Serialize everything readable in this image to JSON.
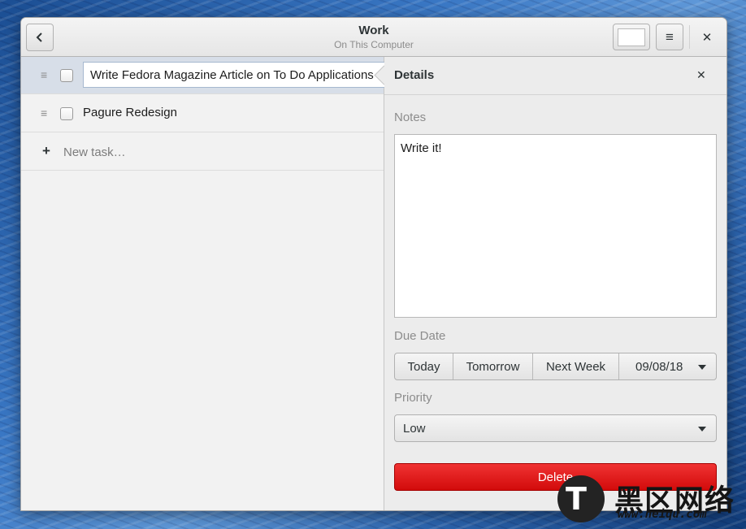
{
  "window": {
    "title": "Work",
    "subtitle": "On This Computer"
  },
  "headerbar": {
    "back_icon": "chevron-left-icon",
    "menu_icon": "hamburger-menu-icon",
    "close_icon": "close-icon"
  },
  "tasks": [
    {
      "title": "Write Fedora Magazine Article on To Do Applications",
      "done": false,
      "selected": true
    },
    {
      "title": "Pagure Redesign",
      "done": false,
      "selected": false
    }
  ],
  "new_task_placeholder": "New task…",
  "details": {
    "title": "Details",
    "notes_label": "Notes",
    "notes": "Write it!",
    "due_date_label": "Due Date",
    "due_buttons": [
      "Today",
      "Tomorrow",
      "Next Week"
    ],
    "due_date_value": "09/08/18",
    "priority_label": "Priority",
    "priority_value": "Low",
    "delete_label": "Delete"
  },
  "watermark": {
    "text": "黑区网络",
    "url": "www.heiqu.com"
  },
  "colors": {
    "selection": "#d7dee8",
    "delete": "#e51c1c",
    "accent": "#a6b8cf"
  }
}
